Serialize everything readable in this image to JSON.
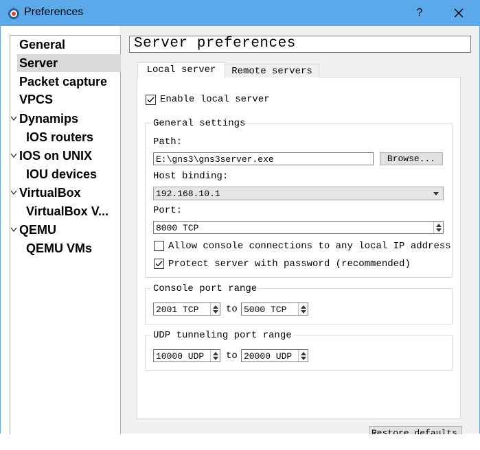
{
  "window": {
    "title": "Preferences",
    "help_label": "?",
    "accent": "#5ba9ea"
  },
  "nav": {
    "items": [
      {
        "label": "General",
        "level": 0,
        "selected": false
      },
      {
        "label": "Server",
        "level": 0,
        "selected": true
      },
      {
        "label": "Packet capture",
        "level": 0,
        "selected": false
      },
      {
        "label": "VPCS",
        "level": 0,
        "selected": false
      },
      {
        "label": "Dynamips",
        "level": 0,
        "expanded": true
      },
      {
        "label": "IOS routers",
        "level": 1
      },
      {
        "label": "IOS on UNIX",
        "level": 0,
        "expanded": true
      },
      {
        "label": "IOU devices",
        "level": 1
      },
      {
        "label": "VirtualBox",
        "level": 0,
        "expanded": true
      },
      {
        "label": "VirtualBox V...",
        "level": 1
      },
      {
        "label": "QEMU",
        "level": 0,
        "expanded": true
      },
      {
        "label": "QEMU VMs",
        "level": 1
      }
    ]
  },
  "page": {
    "header": "Server preferences"
  },
  "tabs": [
    {
      "label": "Local server",
      "active": true
    },
    {
      "label": "Remote servers",
      "active": false
    }
  ],
  "local": {
    "enable_label": "Enable local server",
    "enable_checked": true,
    "general_title": "General settings",
    "path_label": "Path:",
    "path_value": "E:\\gns3\\gns3server.exe",
    "browse_label": "Browse...",
    "binding_label": "Host binding:",
    "binding_value": "192.168.10.1",
    "port_label": "Port:",
    "port_value": "8000 TCP",
    "allow_label": "Allow console connections to any local IP address",
    "allow_checked": false,
    "protect_label": "Protect server with password (recommended)",
    "protect_checked": true,
    "console_title": "Console port range",
    "console_from": "2001 TCP",
    "console_to": "5000 TCP",
    "udp_title": "UDP tunneling port range",
    "udp_from": "10000 UDP",
    "udp_to": "20000 UDP",
    "to_label": "to"
  },
  "footer": {
    "restore_label": "Restore defaults"
  }
}
